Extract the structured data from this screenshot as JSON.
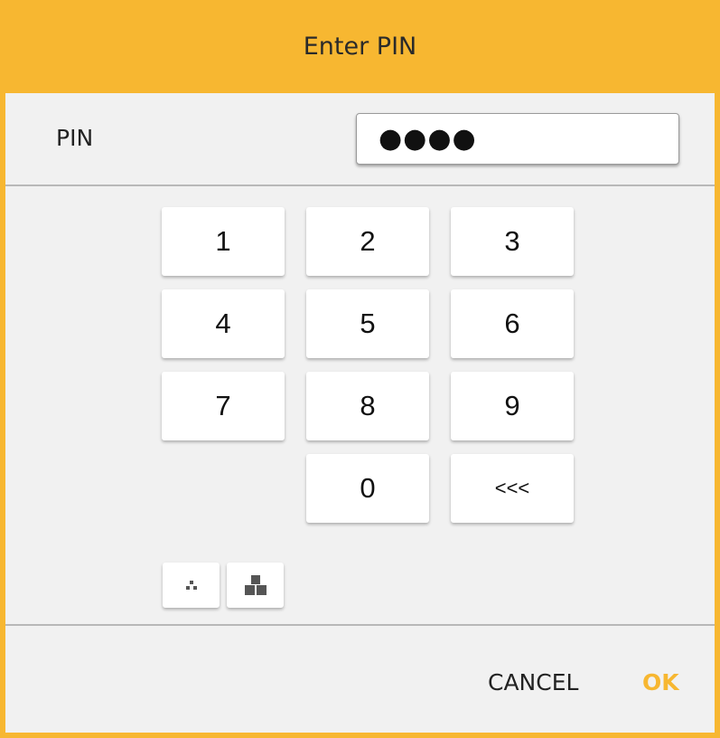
{
  "dialog": {
    "title": "Enter PIN",
    "accent_color": "#f7b731"
  },
  "pin": {
    "label": "PIN",
    "masked_value": "●●●●"
  },
  "keypad": {
    "keys": [
      "1",
      "2",
      "3",
      "4",
      "5",
      "6",
      "7",
      "8",
      "9",
      "0"
    ],
    "backspace_label": "<<<"
  },
  "layout_toggles": [
    {
      "icon": "small-blocks-icon"
    },
    {
      "icon": "large-blocks-icon"
    }
  ],
  "footer": {
    "cancel_label": "CANCEL",
    "ok_label": "OK"
  }
}
